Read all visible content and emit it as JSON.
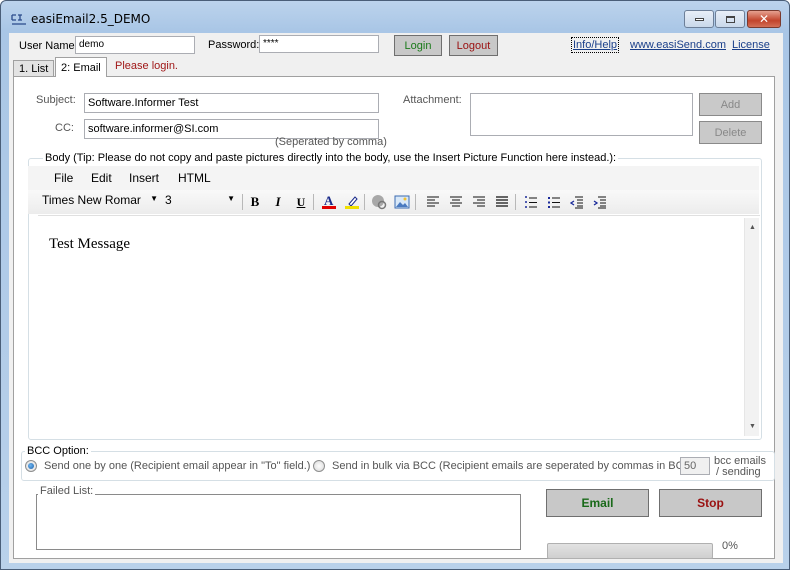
{
  "window": {
    "title": "easiEmail2.5_DEMO",
    "controls": {
      "minimize": "–",
      "maximize": "□",
      "close": "✕"
    }
  },
  "login": {
    "username_label": "User Name:",
    "username_value": "demo",
    "password_label": "Password:",
    "password_value": "****",
    "login_button": "Login",
    "logout_button": "Logout"
  },
  "links": {
    "info_help": "Info/Help",
    "website": "www.easiSend.com",
    "license": "License"
  },
  "tabs": [
    {
      "label": "1. List",
      "active": false
    },
    {
      "label": "2: Email",
      "active": true
    }
  ],
  "status_message": "Please login.",
  "email": {
    "subject_label": "Subject:",
    "subject_value": "Software.Informer Test",
    "cc_label": "CC:",
    "cc_value": "software.informer@SI.com",
    "cc_hint": "(Seperated by comma)",
    "attachment_label": "Attachment:",
    "attachment_items": [],
    "add_button": "Add",
    "delete_button": "Delete"
  },
  "body": {
    "group_title": "Body (Tip: Please do not copy and paste pictures directly into the body, use the Insert Picture Function here instead.):",
    "menu": [
      "File",
      "Edit",
      "Insert",
      "HTML"
    ],
    "font_name": "Times New Romar",
    "font_size": "3",
    "toolbar_icons": [
      "bold-icon",
      "italic-icon",
      "underline-icon",
      "font-color-icon",
      "highlight-icon",
      "insert-link-icon",
      "insert-picture-icon",
      "align-left-icon",
      "align-center-icon",
      "align-right-icon",
      "justify-icon",
      "numbered-list-icon",
      "bullet-list-icon",
      "outdent-icon",
      "indent-icon"
    ],
    "content": "Test Message"
  },
  "bcc": {
    "group_title": "BCC Option:",
    "option_one": "Send one by one (Recipient email appear in \"To\" field.)",
    "option_bulk": "Send in bulk via BCC (Recipient emails are seperated by commas in BCC)",
    "selected": "one_by_one",
    "bulk_count": "50",
    "bulk_unit_line1": "bcc emails",
    "bulk_unit_line2": "/ sending"
  },
  "failed_list": {
    "label": "Failed List:",
    "items": []
  },
  "actions": {
    "email_button": "Email",
    "stop_button": "Stop"
  },
  "progress": {
    "percent": 0,
    "label": "0%"
  },
  "colors": {
    "login_text": "#1a7a1a",
    "logout_text": "#9a1010",
    "status_text": "#a01818",
    "link": "#1a3f8a"
  }
}
